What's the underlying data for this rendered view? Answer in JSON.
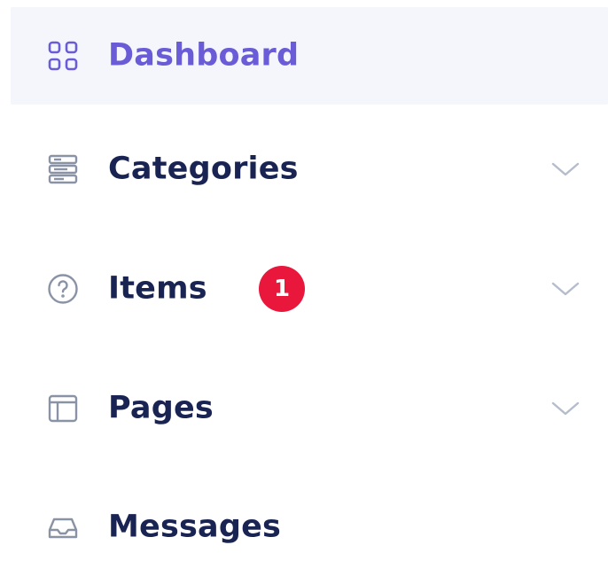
{
  "sidebar": {
    "items": [
      {
        "label": "Dashboard",
        "icon": "dashboard-grid-icon",
        "active": true,
        "has_submenu": false
      },
      {
        "label": "Categories",
        "icon": "categories-stack-icon",
        "active": false,
        "has_submenu": true
      },
      {
        "label": "Items",
        "icon": "question-circle-icon",
        "active": false,
        "has_submenu": true,
        "badge": "1"
      },
      {
        "label": "Pages",
        "icon": "layout-window-icon",
        "active": false,
        "has_submenu": true
      },
      {
        "label": "Messages",
        "icon": "inbox-tray-icon",
        "active": false,
        "has_submenu": false
      }
    ]
  },
  "colors": {
    "active_text": "#6a5bd6",
    "text": "#1a2453",
    "active_bg": "#f4f6fc",
    "icon": "#8a93a6",
    "badge_bg": "#e8173b",
    "chevron": "#b5bccb"
  }
}
